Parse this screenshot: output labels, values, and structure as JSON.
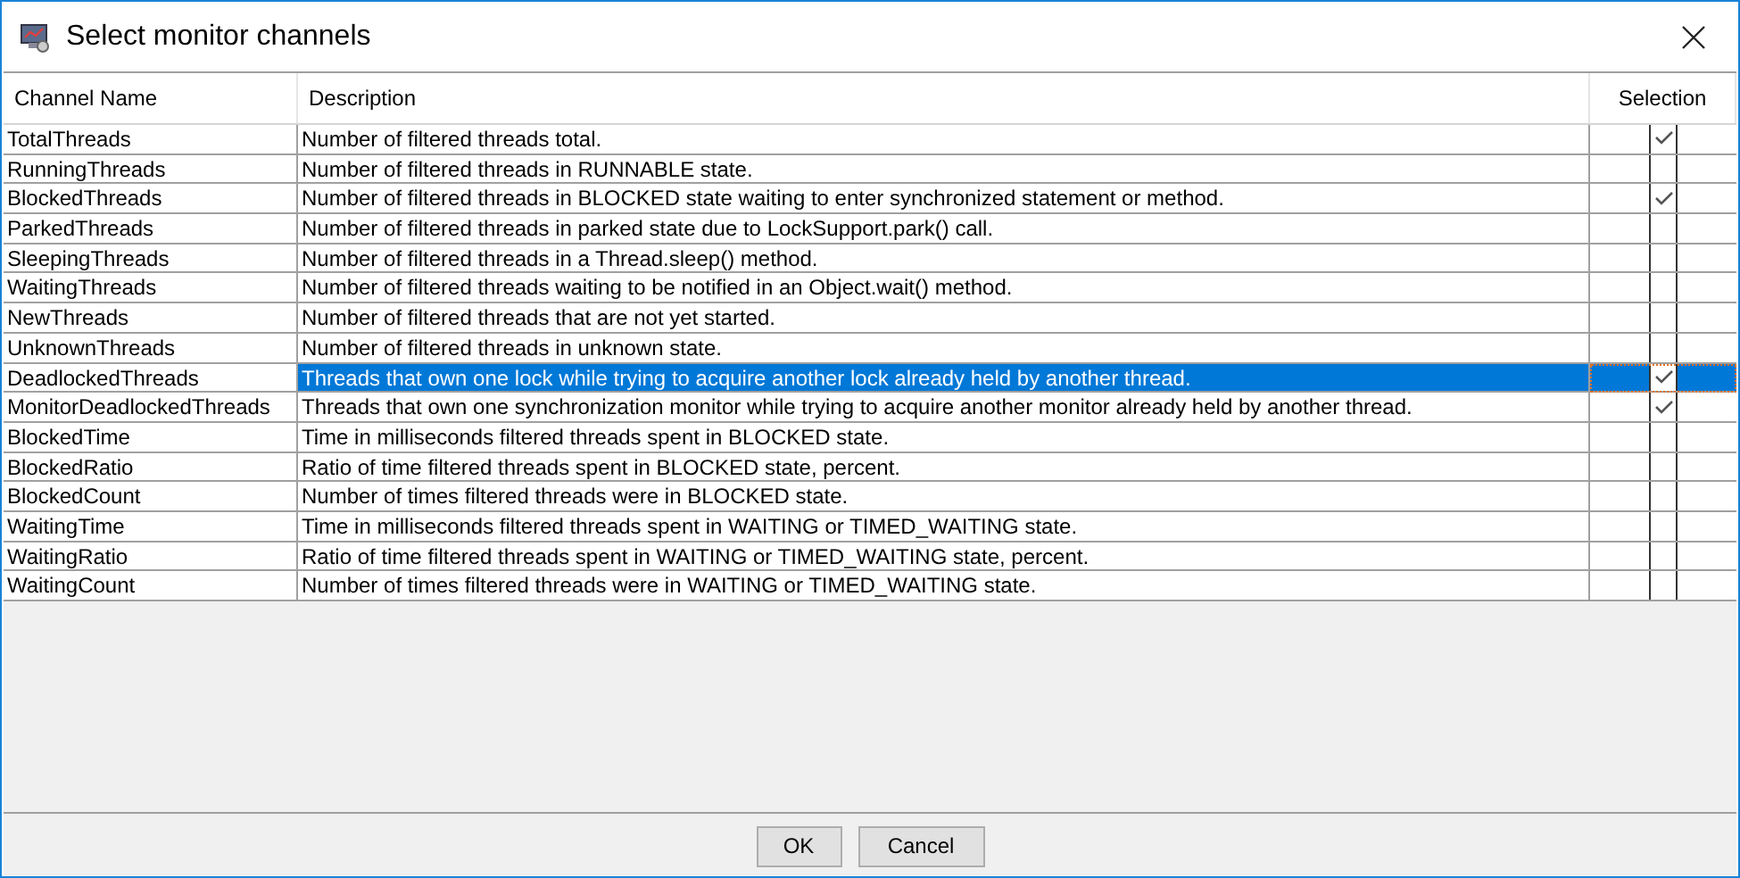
{
  "window": {
    "title": "Select monitor channels"
  },
  "table": {
    "columns": [
      "Channel Name",
      "Description",
      "Selection"
    ],
    "rows": [
      {
        "name": "TotalThreads",
        "description": "Number of filtered threads total.",
        "checked": true,
        "selected": false
      },
      {
        "name": "RunningThreads",
        "description": "Number of filtered threads in RUNNABLE state.",
        "checked": false,
        "selected": false
      },
      {
        "name": "BlockedThreads",
        "description": "Number of filtered threads in BLOCKED state waiting to enter synchronized statement or method.",
        "checked": true,
        "selected": false
      },
      {
        "name": "ParkedThreads",
        "description": "Number of filtered threads in parked state due to LockSupport.park() call.",
        "checked": false,
        "selected": false
      },
      {
        "name": "SleepingThreads",
        "description": "Number of filtered threads in a Thread.sleep() method.",
        "checked": false,
        "selected": false
      },
      {
        "name": "WaitingThreads",
        "description": "Number of filtered threads waiting to be notified in an Object.wait() method.",
        "checked": false,
        "selected": false
      },
      {
        "name": "NewThreads",
        "description": "Number of filtered threads that are not yet started.",
        "checked": false,
        "selected": false
      },
      {
        "name": "UnknownThreads",
        "description": "Number of filtered threads in unknown state.",
        "checked": false,
        "selected": false
      },
      {
        "name": "DeadlockedThreads",
        "description": "Threads that own one lock while trying to acquire another lock already held by another thread.",
        "checked": true,
        "selected": true
      },
      {
        "name": "MonitorDeadlockedThreads",
        "description": "Threads that own one synchronization monitor while trying to acquire another monitor already held by another thread.",
        "checked": true,
        "selected": false
      },
      {
        "name": "BlockedTime",
        "description": "Time in milliseconds filtered threads spent in BLOCKED state.",
        "checked": false,
        "selected": false
      },
      {
        "name": "BlockedRatio",
        "description": "Ratio of time filtered threads spent in BLOCKED state, percent.",
        "checked": false,
        "selected": false
      },
      {
        "name": "BlockedCount",
        "description": "Number of times filtered threads were in BLOCKED state.",
        "checked": false,
        "selected": false
      },
      {
        "name": "WaitingTime",
        "description": "Time in milliseconds filtered threads spent in WAITING or TIMED_WAITING state.",
        "checked": false,
        "selected": false
      },
      {
        "name": "WaitingRatio",
        "description": "Ratio of time filtered threads spent in WAITING or TIMED_WAITING state, percent.",
        "checked": false,
        "selected": false
      },
      {
        "name": "WaitingCount",
        "description": "Number of times filtered threads were in WAITING or TIMED_WAITING state.",
        "checked": false,
        "selected": false
      }
    ]
  },
  "buttons": [
    "OK",
    "Cancel"
  ]
}
